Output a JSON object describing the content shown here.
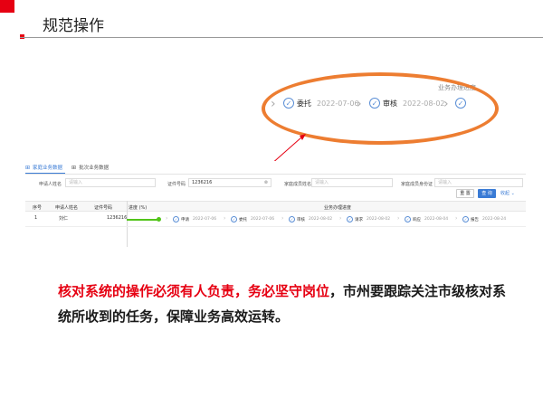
{
  "slide": {
    "title": "规范操作",
    "caption_highlight": "核对系统的操作必须有人负责，务必坚守岗位",
    "caption_rest": "，市州要跟踪关注市级核对系统所收到的任务，保障业务高效运转。",
    "colors": {
      "accent": "#e60012",
      "oval": "#ed7d31",
      "primary": "#3a7bd5",
      "progress": "#52c41a"
    }
  },
  "zoom": {
    "header": "业务办理进度",
    "steps": [
      {
        "name": "委托",
        "date": "2022-07-06",
        "icon": "check-circle-icon"
      },
      {
        "name": "审核",
        "date": "2022-08-02",
        "icon": "check-circle-icon"
      },
      {
        "name": "",
        "date": "",
        "icon": "check-circle-icon"
      }
    ]
  },
  "app": {
    "tabs": [
      {
        "label": "家庭业务数据",
        "icon": "grid-icon",
        "active": true
      },
      {
        "label": "批次业务数据",
        "icon": "grid-icon",
        "active": false
      }
    ],
    "filters": {
      "applicant_label": "申请人姓名",
      "applicant_placeholder": "请输入",
      "id_label": "证件号码",
      "id_value": "1236216",
      "family_name_label": "家庭成员姓名",
      "family_name_placeholder": "请输入",
      "family_id_label": "家庭成员身份证",
      "family_id_placeholder": "请输入"
    },
    "buttons": {
      "reset": "重 置",
      "search": "查 询",
      "collapse": "收起 ⌄"
    },
    "table": {
      "headers": [
        "序号",
        "申请人姓名",
        "证件号码",
        "进度 (%)",
        "业务办理进度"
      ],
      "row": {
        "index": "1",
        "name": "刘仁",
        "id": "1236216",
        "progress": 1.0
      },
      "steps": [
        {
          "name": "申请",
          "date": "2022-07-06"
        },
        {
          "name": "委托",
          "date": "2022-07-06"
        },
        {
          "name": "审核",
          "date": "2022-08-02"
        },
        {
          "name": "请求",
          "date": "2022-08-02"
        },
        {
          "name": "响应",
          "date": "2022-08-04"
        },
        {
          "name": "报告",
          "date": "2022-08-24"
        }
      ]
    }
  }
}
